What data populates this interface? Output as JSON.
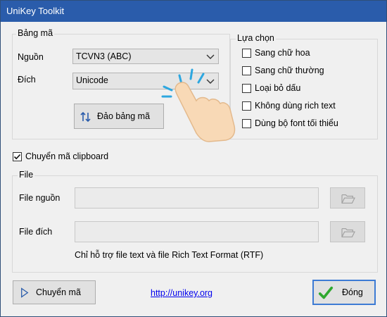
{
  "window": {
    "title": "UniKey Toolkit"
  },
  "bang_ma": {
    "legend": "Bảng mã",
    "source_label": "Nguồn",
    "source_value": "TCVN3 (ABC)",
    "target_label": "Đích",
    "target_value": "Unicode",
    "swap_button": "Đảo bảng mã"
  },
  "lua_chon": {
    "legend": "Lựa chọn",
    "options": [
      {
        "label": "Sang chữ hoa",
        "checked": false
      },
      {
        "label": "Sang chữ thường",
        "checked": false
      },
      {
        "label": "Loại bỏ dấu",
        "checked": false
      },
      {
        "label": "Không dùng rich text",
        "checked": false
      },
      {
        "label": "Dùng bộ font tối thiểu",
        "checked": false
      }
    ]
  },
  "clipboard": {
    "label": "Chuyển mã clipboard",
    "checked": true
  },
  "file": {
    "legend": "File",
    "source_label": "File nguồn",
    "source_value": "",
    "target_label": "File đích",
    "target_value": "",
    "note": "Chỉ hỗ trợ file text và file Rich Text Format (RTF)"
  },
  "footer": {
    "convert_button": "Chuyển mã",
    "link": "http://unikey.org",
    "close_button": "Đóng"
  },
  "colors": {
    "titlebar": "#2a5cab",
    "check_green": "#2fa82f",
    "link": "#0000ee"
  }
}
